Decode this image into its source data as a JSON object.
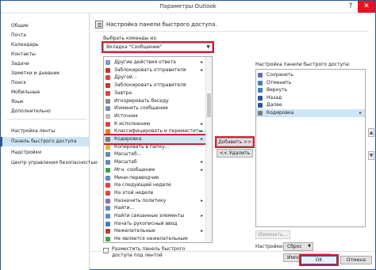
{
  "window": {
    "title": "Параметры Outlook",
    "help": "?",
    "close": "✕"
  },
  "sidebar": {
    "items": [
      "Общие",
      "Почта",
      "Календарь",
      "Контакты",
      "Задачи",
      "Заметки и дневник",
      "Поиск",
      "Мобильные",
      "Язык",
      "Дополнительно",
      "Настройка ленты",
      "Панель быстрого доступа",
      "Надстройки",
      "Центр управления безопасностью"
    ],
    "active_index": 11
  },
  "header": {
    "text": "Настройка панели быстрого доступа."
  },
  "choose": {
    "label": "Выбрать команды из:",
    "value": "Вкладка \"Сообщение\""
  },
  "commands": [
    {
      "label": "Другие действия ответа",
      "icon": "reply-icon",
      "color": "#7a9cc6",
      "submenu": true
    },
    {
      "label": "Заблокировать отправителя",
      "icon": "block-icon",
      "color": "#c0392b",
      "submenu": true
    },
    {
      "label": "Другой...",
      "icon": "flag-icon",
      "color": "#d64541"
    },
    {
      "label": "Заблокировать отправителя",
      "icon": "block-icon",
      "color": "#c0392b"
    },
    {
      "label": "Завтра",
      "icon": "flag-icon",
      "color": "#d64541"
    },
    {
      "label": "Игнорировать беседу",
      "icon": "ignore-icon",
      "color": "#8e8e8e"
    },
    {
      "label": "Изменить сообщение",
      "icon": "edit-icon",
      "color": "#6f8fb6"
    },
    {
      "label": "Источник",
      "icon": "source-icon",
      "color": "#b9b9b9"
    },
    {
      "label": "К исполнению",
      "icon": "flag-icon",
      "color": "#d64541",
      "submenu": true
    },
    {
      "label": "Классифицировать и переместить...",
      "icon": "category-icon",
      "color": "#e67e22",
      "submenu": true
    },
    {
      "label": "Кодировка",
      "icon": "encoding-icon",
      "color": "#7b7b7b",
      "submenu": true
    },
    {
      "label": "Копировать в папку...",
      "icon": "copy-folder-icon",
      "color": "#e2b33d"
    },
    {
      "label": "Масштаб...",
      "icon": "zoom-icon",
      "color": "#5d8ac4"
    },
    {
      "label": "Масштаб",
      "icon": "zoom-icon",
      "color": "#5d8ac4",
      "submenu": true
    },
    {
      "label": "Мгн. сообщение",
      "icon": "im-icon",
      "color": "#3fa34d",
      "submenu": true
    },
    {
      "label": "Мини-переводчик",
      "icon": "translate-icon",
      "color": "#5d8ac4"
    },
    {
      "label": "На следующей неделе",
      "icon": "flag-icon",
      "color": "#d64541"
    },
    {
      "label": "На этой неделе",
      "icon": "flag-icon",
      "color": "#d64541"
    },
    {
      "label": "Назначить политику",
      "icon": "policy-icon",
      "color": "#8e6fb6",
      "submenu": true
    },
    {
      "label": "Найти...",
      "icon": "find-icon",
      "color": "#5d8ac4"
    },
    {
      "label": "Найти связанные элементы",
      "icon": "related-icon",
      "color": "#5d8ac4",
      "submenu": true
    },
    {
      "label": "Начать рукописный ввод",
      "icon": "ink-icon",
      "color": "#3f7fbf"
    },
    {
      "label": "Нежелательные",
      "icon": "junk-icon",
      "color": "#c0392b",
      "submenu": true
    },
    {
      "label": "Не является нежелательным",
      "icon": "not-junk-icon",
      "color": "#3fa34d"
    }
  ],
  "buttons": {
    "add": "Добавить >>",
    "remove": "<< Удалить",
    "modify": "Изменить...",
    "ok": "OK",
    "cancel": "Отмена"
  },
  "qat": {
    "label": "Настройка панели быстрого доступа:",
    "items": [
      {
        "label": "Сохранить",
        "icon": "save-icon",
        "color": "#5d6fb6"
      },
      {
        "label": "Отменить",
        "icon": "undo-icon",
        "color": "#3f7fbf"
      },
      {
        "label": "Вернуть",
        "icon": "redo-icon",
        "color": "#3f7fbf"
      },
      {
        "label": "Назад",
        "icon": "back-icon",
        "color": "#2b579a"
      },
      {
        "label": "Далее",
        "icon": "forward-icon",
        "color": "#2b579a"
      },
      {
        "label": "Кодировка",
        "icon": "encoding-icon",
        "color": "#7b7b7b",
        "submenu": true
      }
    ],
    "selected_index": 5
  },
  "settings": {
    "label": "Настройки:",
    "reset": "Сброс",
    "import_export": "Импорт-экспорт"
  },
  "below_ribbon": {
    "label": "Разместить панель быстрого доступа под лентой"
  }
}
